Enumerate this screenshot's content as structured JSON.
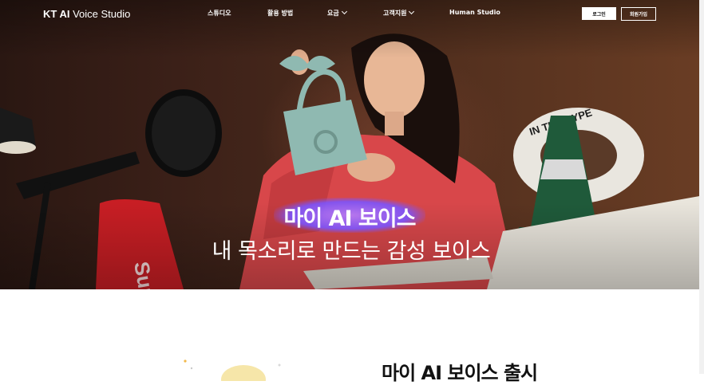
{
  "brand": {
    "logo_bold": "KT AI",
    "logo_rest": " Voice Studio"
  },
  "nav": {
    "items": [
      {
        "label": "스튜디오",
        "has_dropdown": false
      },
      {
        "label": "활용 방법",
        "has_dropdown": false
      },
      {
        "label": "요금",
        "has_dropdown": true
      },
      {
        "label": "고객지원",
        "has_dropdown": true
      },
      {
        "label": "Human Studio",
        "has_dropdown": false
      }
    ],
    "login_label": "로그인",
    "signup_label": "회원가입"
  },
  "hero": {
    "title": "마이 AI 보이스",
    "subtitle": "내 목소리로 만드는 감성 보이스",
    "accent_color": "#8a5cff"
  },
  "section": {
    "title": "마이 AI 보이스 출시"
  }
}
